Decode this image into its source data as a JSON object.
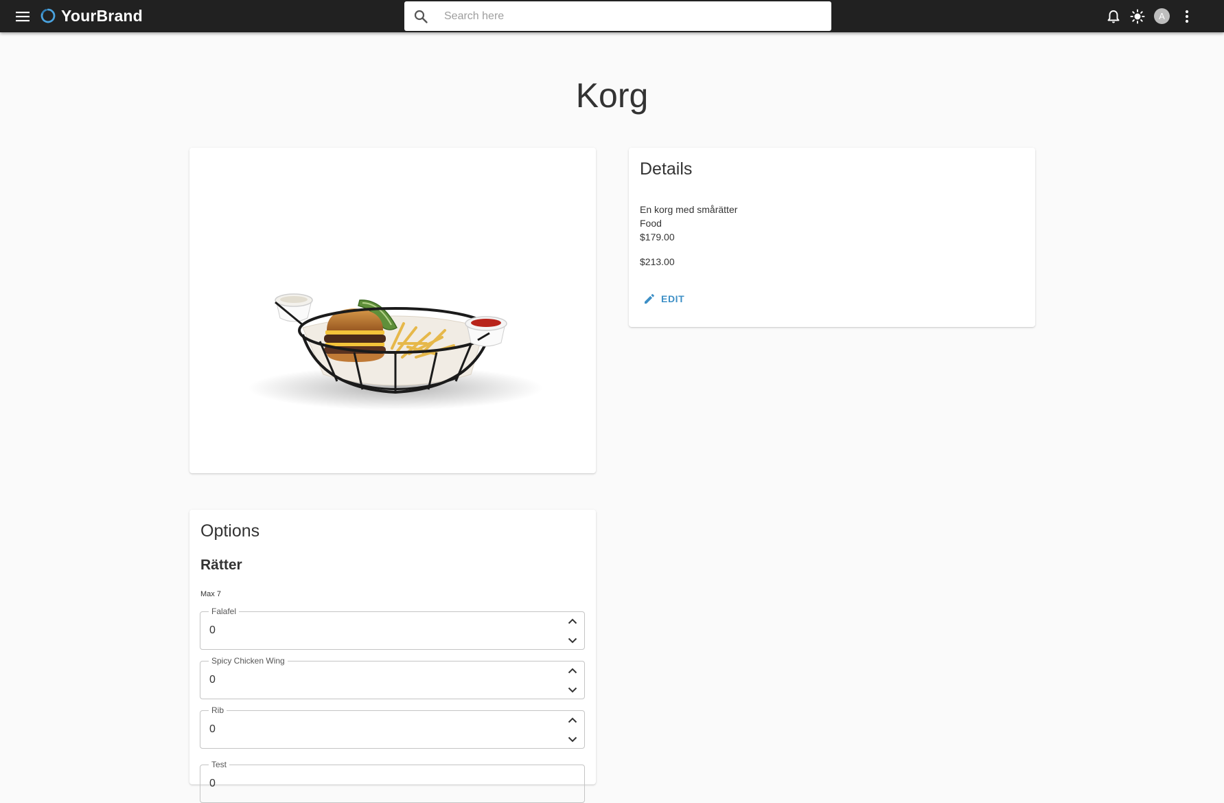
{
  "app": {
    "brand": "YourBrand",
    "brand_color": "#3d8fc6",
    "topbar_color": "#212121"
  },
  "search": {
    "placeholder": "Search here",
    "value": ""
  },
  "topbar": {
    "icons": [
      "menu-icon",
      "bell-icon",
      "brightness-icon",
      "avatar",
      "more-vert-icon"
    ],
    "avatar_initial": "A"
  },
  "page": {
    "title": "Korg"
  },
  "image_card": {
    "image": "food basket with burger, fries, cucumber and two dip cups"
  },
  "details": {
    "title": "Details",
    "description": "En korg med smårätter",
    "category": "Food",
    "price": "$179.00",
    "price_secondary": "$213.00",
    "edit_label": "EDIT",
    "accent_color": "#3d8fc6"
  },
  "options": {
    "title": "Options",
    "section_title": "Rätter",
    "max_label": "Max 7",
    "fields": [
      {
        "label": "Falafel",
        "value": "0"
      },
      {
        "label": "Spicy Chicken Wing",
        "value": "0"
      },
      {
        "label": "Rib",
        "value": "0"
      },
      {
        "label": "Test",
        "value": "0"
      }
    ]
  }
}
